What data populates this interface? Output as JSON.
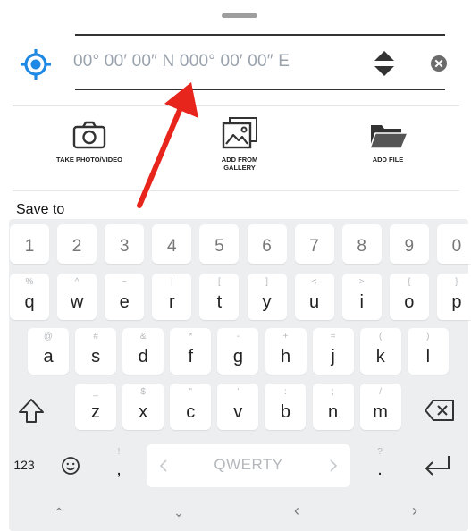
{
  "location": {
    "coordinate_placeholder": "00° 00′ 00″ N 000° 00′ 00″ E",
    "locate_icon": "crosshair-icon",
    "sort_icon": "up-down-arrows-icon",
    "clear_icon": "clear-x-icon"
  },
  "actions": [
    {
      "label": "TAKE PHOTO/VIDEO",
      "icon": "camera-icon"
    },
    {
      "label": "ADD FROM\nGALLERY",
      "icon": "gallery-icon"
    },
    {
      "label": "ADD FILE",
      "icon": "folder-icon"
    }
  ],
  "save_to_label": "Save to",
  "colors": {
    "accent": "#1e88e5",
    "annotation_arrow": "#e8251d"
  },
  "keyboard": {
    "number_row": [
      "1",
      "2",
      "3",
      "4",
      "5",
      "6",
      "7",
      "8",
      "9",
      "0"
    ],
    "row1": [
      {
        "main": "q",
        "sub": "%"
      },
      {
        "main": "w",
        "sub": "^"
      },
      {
        "main": "e",
        "sub": "~"
      },
      {
        "main": "r",
        "sub": "|"
      },
      {
        "main": "t",
        "sub": "["
      },
      {
        "main": "y",
        "sub": "]"
      },
      {
        "main": "u",
        "sub": "<"
      },
      {
        "main": "i",
        "sub": ">"
      },
      {
        "main": "o",
        "sub": "{"
      },
      {
        "main": "p",
        "sub": "}"
      }
    ],
    "row2": [
      {
        "main": "a",
        "sub": "@"
      },
      {
        "main": "s",
        "sub": "#"
      },
      {
        "main": "d",
        "sub": "&"
      },
      {
        "main": "f",
        "sub": "*"
      },
      {
        "main": "g",
        "sub": "-"
      },
      {
        "main": "h",
        "sub": "+"
      },
      {
        "main": "j",
        "sub": "="
      },
      {
        "main": "k",
        "sub": "("
      },
      {
        "main": "l",
        "sub": ")"
      }
    ],
    "row3": [
      {
        "main": "z",
        "sub": "_"
      },
      {
        "main": "x",
        "sub": "$"
      },
      {
        "main": "c",
        "sub": "\""
      },
      {
        "main": "v",
        "sub": "'"
      },
      {
        "main": "b",
        "sub": ":"
      },
      {
        "main": "n",
        "sub": ";"
      },
      {
        "main": "m",
        "sub": "/"
      }
    ],
    "symbols_label": "123",
    "space_label": "QWERTY",
    "comma_sub": "!",
    "comma": ",",
    "period_sub": "?",
    "period": ".",
    "shift_icon": "shift-icon",
    "backspace_icon": "backspace-icon",
    "enter_icon": "enter-icon",
    "emoji_icon": "emoji-icon",
    "space_left_icon": "chevron-left-icon",
    "space_right_icon": "chevron-right-icon",
    "nav": [
      "⌃",
      "⌄",
      "‹",
      "›"
    ]
  }
}
